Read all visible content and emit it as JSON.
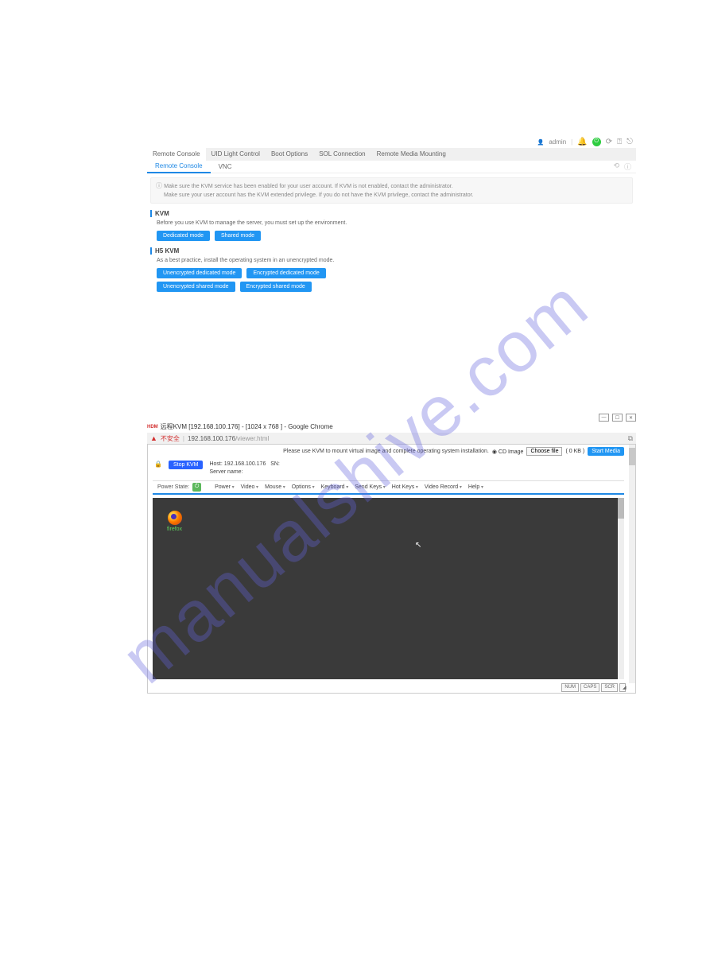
{
  "watermark": "manualshive.com",
  "upper": {
    "user_label": "admin",
    "main_tabs": [
      "Remote Console",
      "UID Light Control",
      "Boot Options",
      "SOL Connection",
      "Remote Media Mounting"
    ],
    "active_main_tab": 0,
    "sub_tabs": [
      "Remote Console",
      "VNC"
    ],
    "active_sub_tab": 0,
    "banner_line1": "Make sure the KVM service has been enabled for your user account. If KVM is not enabled, contact the administrator.",
    "banner_line2": "Make sure your user account has the KVM extended privilege. If you do not have the KVM privilege, contact the administrator.",
    "kvm": {
      "title": "KVM",
      "text": "Before you use KVM to manage the server, you must set up the environment.",
      "buttons": [
        "Dedicated mode",
        "Shared mode"
      ]
    },
    "h5kvm": {
      "title": "H5 KVM",
      "text": "As a best practice, install the operating system in an unencrypted mode.",
      "buttons_row1": [
        "Unencrypted dedicated mode",
        "Encrypted dedicated mode"
      ],
      "buttons_row2": [
        "Unencrypted shared mode",
        "Encrypted shared mode"
      ]
    }
  },
  "lower": {
    "chrome_title_prefix": "HDM",
    "chrome_title": "远程KVM [192.168.100.176] - [1024 x 768 ] - Google Chrome",
    "not_secure": "不安全",
    "url_host": "192.168.100.176",
    "url_path": "/viewer.html",
    "notice": "Please use KVM to mount virtual image and complete operating system installation.",
    "cd_image": "CD Image",
    "choose_file": "Choose file",
    "file_size": "( 0 KB )",
    "start_media": "Start Media",
    "stop_kvm": "Stop KVM",
    "host_label": "Host:",
    "host_ip": "192.168.100.176",
    "sn_label": "SN:",
    "server_name_label": "Server name:",
    "power_state_label": "Power State:",
    "menus": [
      "Power",
      "Video",
      "Mouse",
      "Options",
      "Keyboard",
      "Send Keys",
      "Hot Keys",
      "Video Record",
      "Help"
    ],
    "firefox_label": "firefox",
    "status": [
      "NUM",
      "CAPS",
      "SCR"
    ]
  }
}
